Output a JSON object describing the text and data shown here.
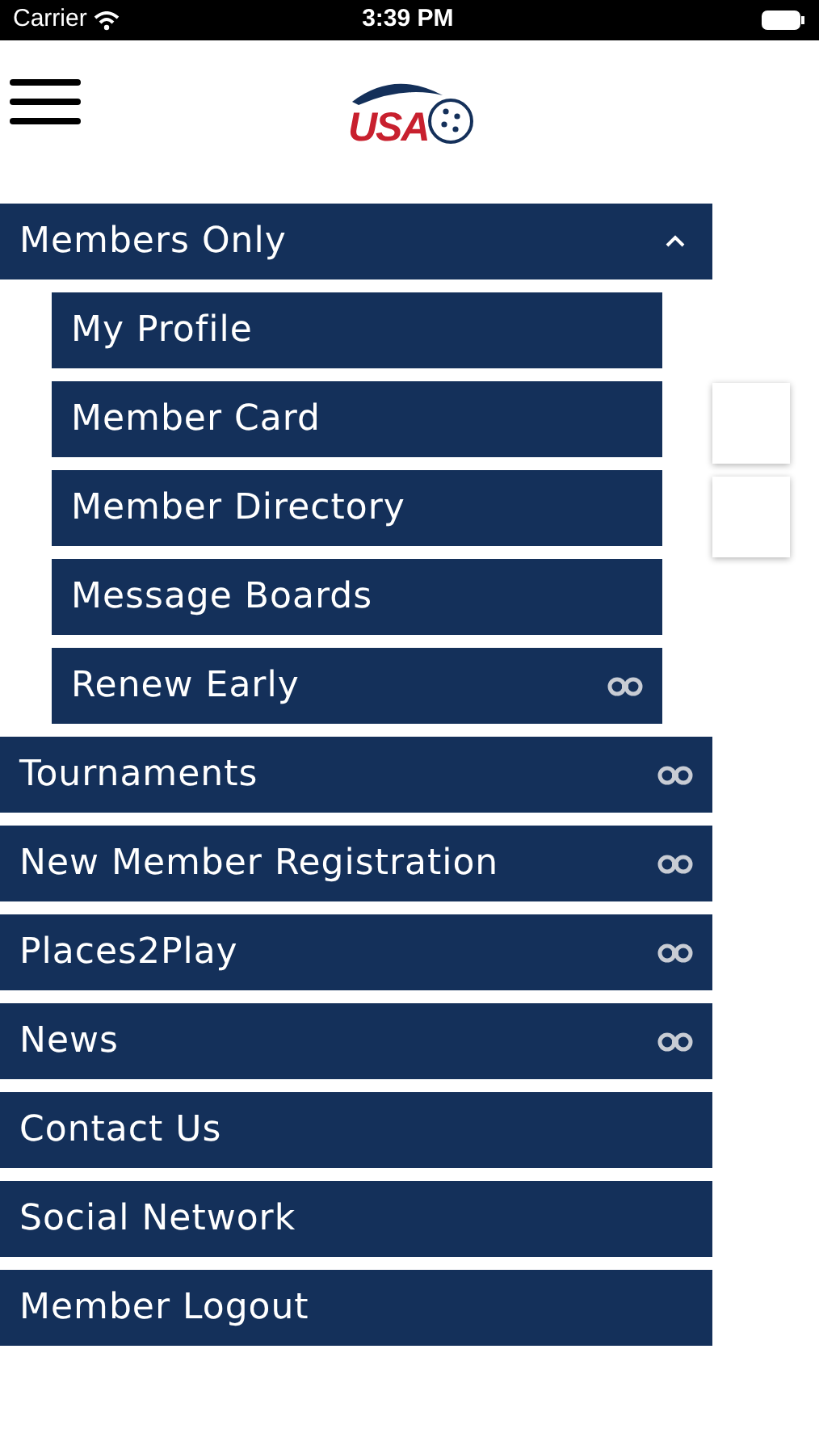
{
  "status_bar": {
    "carrier": "Carrier",
    "time": "3:39 PM"
  },
  "header": {
    "logo_text": "USA"
  },
  "menu": [
    {
      "label": "Members Only",
      "expanded": true,
      "children": [
        {
          "label": "My Profile",
          "link": false
        },
        {
          "label": "Member Card",
          "link": false
        },
        {
          "label": "Member Directory",
          "link": false
        },
        {
          "label": "Message Boards",
          "link": false
        },
        {
          "label": "Renew Early",
          "link": true
        }
      ]
    },
    {
      "label": "Tournaments",
      "link": true
    },
    {
      "label": "New Member Registration",
      "link": true
    },
    {
      "label": "Places2Play",
      "link": true
    },
    {
      "label": "News",
      "link": true
    },
    {
      "label": "Contact Us",
      "link": false
    },
    {
      "label": "Social Network",
      "link": false
    },
    {
      "label": "Member Logout",
      "link": false
    }
  ]
}
